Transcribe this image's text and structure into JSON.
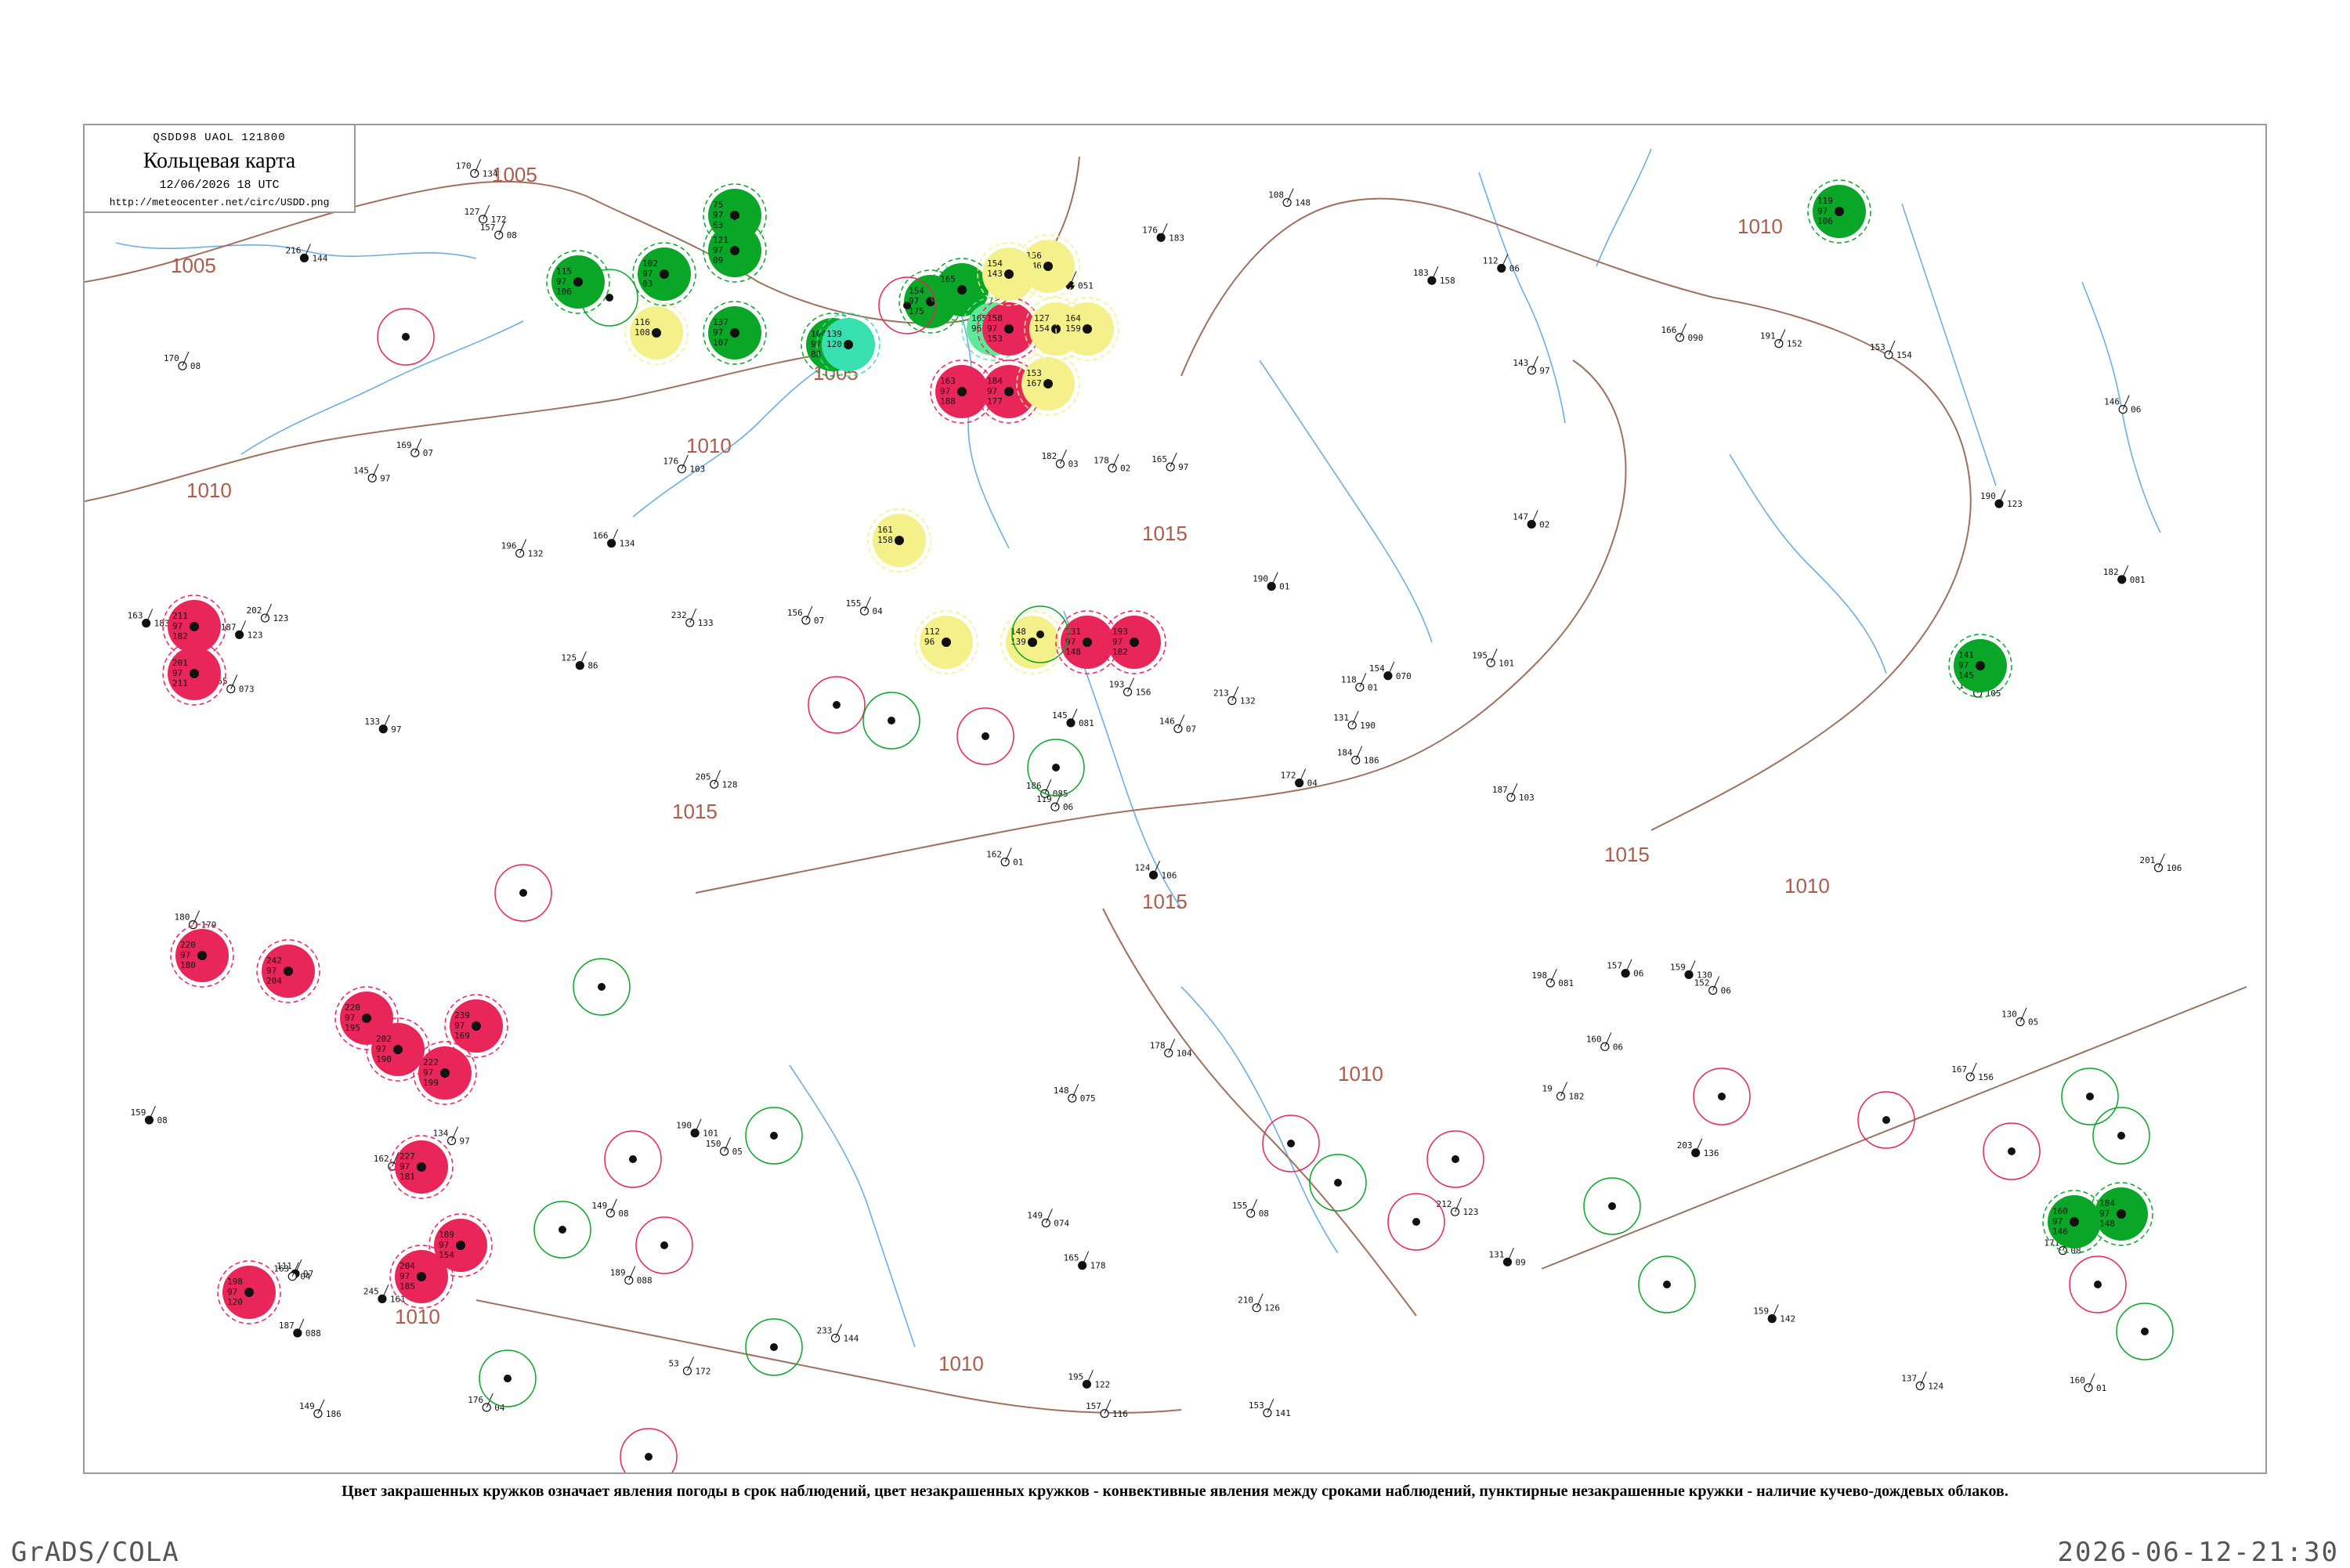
{
  "header": {
    "code": "QSDD98  UAOL  121800",
    "title": "Кольцевая карта",
    "date": "12/06/2026 18 UTC",
    "url": "http://meteocenter.net/circ/USDD.png"
  },
  "caption": "Цвет закрашенных кружков означает явления погоды в срок наблюдений, цвет незакрашенных кружков - конвективные явления между сроками наблюдений, пунктирные незакрашенные кружки - наличие кучево-дождевых облаков.",
  "footer": {
    "left": "GrADS/COLA",
    "right": "2026-06-12-21:30"
  },
  "colors": {
    "green": "#0aa628",
    "red": "#e8265a",
    "yellow": "#f4f08a",
    "cyan": "#38e0b0",
    "mint": "#5ee89a",
    "isobar": "#a0705a",
    "river": "#6aaee6"
  },
  "isobars": [
    "1005",
    "1010",
    "1015"
  ],
  "stations": [
    {
      "t": "Fg",
      "c": "green",
      "v": [
        "75",
        "97",
        "63"
      ]
    },
    {
      "t": "Fg",
      "c": "green",
      "v": [
        "121",
        "97",
        "09"
      ]
    },
    {
      "t": "Fg",
      "c": "green",
      "v": [
        "102",
        "97",
        "03"
      ]
    },
    {
      "t": "Fg",
      "c": "green",
      "v": [
        "115",
        "97",
        "106"
      ]
    },
    {
      "t": "Fg",
      "c": "yellow",
      "v": [
        "116",
        "108"
      ]
    },
    {
      "t": "Fg",
      "c": "green",
      "v": [
        "137",
        "97",
        "107"
      ]
    },
    {
      "t": "Fg",
      "c": "green",
      "v": [
        "104",
        "97",
        "88"
      ]
    },
    {
      "t": "Fg",
      "c": "cyan",
      "v": [
        "139",
        "120"
      ]
    },
    {
      "t": "Fg",
      "c": "green",
      "v": [
        "154",
        "97",
        "175"
      ]
    },
    {
      "t": "Fg",
      "c": "green",
      "v": [
        "165"
      ]
    },
    {
      "t": "Fg",
      "c": "mint",
      "v": [
        "165",
        "96"
      ]
    },
    {
      "t": "Fg",
      "c": "red",
      "v": [
        "158",
        "97",
        "153"
      ]
    },
    {
      "t": "Fg",
      "c": "red",
      "v": [
        "163",
        "97",
        "188"
      ]
    },
    {
      "t": "Fg",
      "c": "red",
      "v": [
        "184",
        "97",
        "177"
      ]
    },
    {
      "t": "Fg",
      "c": "yellow",
      "v": [
        "153",
        "167"
      ]
    },
    {
      "t": "Fg",
      "c": "yellow",
      "v": [
        "127",
        "154"
      ]
    },
    {
      "t": "Fg",
      "c": "yellow",
      "v": [
        "164",
        "159"
      ]
    },
    {
      "t": "Fg",
      "c": "yellow",
      "v": [
        "156",
        "146"
      ]
    },
    {
      "t": "Fg",
      "c": "yellow",
      "v": [
        "154",
        "143"
      ]
    },
    {
      "t": "Fg",
      "c": "yellow",
      "v": [
        "161",
        "158"
      ]
    },
    {
      "t": "Fg",
      "c": "yellow",
      "v": [
        "112",
        "96"
      ]
    },
    {
      "t": "Fg",
      "c": "yellow",
      "v": [
        "148",
        "139"
      ]
    },
    {
      "t": "Fg",
      "c": "red",
      "v": [
        "131",
        "97",
        "148"
      ]
    },
    {
      "t": "Fg",
      "c": "red",
      "v": [
        "193",
        "97",
        "182"
      ]
    },
    {
      "t": "Fg",
      "c": "red",
      "v": [
        "211",
        "97",
        "182"
      ]
    },
    {
      "t": "Fg",
      "c": "red",
      "v": [
        "201",
        "97",
        "211"
      ]
    },
    {
      "t": "Fg",
      "c": "red",
      "v": [
        "220",
        "97",
        "180"
      ]
    },
    {
      "t": "Fg",
      "c": "red",
      "v": [
        "242",
        "97",
        "204"
      ]
    },
    {
      "t": "Fg",
      "c": "red",
      "v": [
        "220",
        "97",
        "195"
      ]
    },
    {
      "t": "Fg",
      "c": "red",
      "v": [
        "202",
        "97",
        "190"
      ]
    },
    {
      "t": "Fg",
      "c": "red",
      "v": [
        "222",
        "97",
        "199"
      ]
    },
    {
      "t": "Fg",
      "c": "red",
      "v": [
        "239",
        "97",
        "169"
      ]
    },
    {
      "t": "Fg",
      "c": "red",
      "v": [
        "227",
        "97",
        "181"
      ]
    },
    {
      "t": "Fg",
      "c": "red",
      "v": [
        "204",
        "97",
        "185"
      ]
    },
    {
      "t": "Fg",
      "c": "red",
      "v": [
        "198",
        "97",
        "120"
      ]
    },
    {
      "t": "Fg",
      "c": "red",
      "v": [
        "189",
        "97",
        "154"
      ]
    },
    {
      "t": "Fg",
      "c": "green",
      "v": [
        "119",
        "97",
        "106"
      ]
    },
    {
      "t": "Fg",
      "c": "green",
      "v": [
        "141",
        "97",
        "145"
      ]
    },
    {
      "t": "Fg",
      "c": "green",
      "v": [
        "160",
        "97",
        "146"
      ]
    },
    {
      "t": "Fg",
      "c": "green",
      "v": [
        "184",
        "97",
        "148"
      ]
    }
  ],
  "plain": [
    [
      "124",
      "106"
    ],
    [
      "145",
      "97"
    ],
    [
      "119",
      "06"
    ],
    [
      "111",
      "97"
    ],
    [
      "118",
      "01"
    ],
    [
      "150",
      "05"
    ],
    [
      "112",
      "06"
    ],
    [
      "165",
      "97"
    ],
    [
      "143",
      "97"
    ],
    [
      "172",
      "04"
    ],
    [
      "157",
      "08"
    ],
    [
      "160",
      "01"
    ],
    [
      "133",
      "97"
    ],
    [
      "146",
      "06"
    ],
    [
      "162",
      "01"
    ],
    [
      "147",
      "02"
    ],
    [
      "176",
      "04"
    ],
    [
      "182",
      "03"
    ],
    [
      "190",
      "01"
    ],
    [
      "134",
      "97"
    ],
    [
      "155",
      "04"
    ],
    [
      "187",
      "088"
    ],
    [
      "189",
      "088"
    ],
    [
      "178",
      "02"
    ],
    [
      "154",
      "070"
    ],
    [
      "152",
      "06"
    ],
    [
      "169",
      "07"
    ],
    [
      "214",
      "051"
    ],
    [
      "155",
      "073"
    ],
    [
      "198",
      "081"
    ],
    [
      "182",
      "081"
    ],
    [
      "186",
      "085"
    ],
    [
      "149",
      "074"
    ],
    [
      "145",
      "081"
    ],
    [
      "176",
      "103"
    ],
    [
      "166",
      "090"
    ],
    [
      "190",
      "101"
    ],
    [
      "137",
      "124"
    ],
    [
      "171",
      "08"
    ],
    [
      "159",
      "130"
    ],
    [
      "108",
      "148"
    ],
    [
      "156",
      "07"
    ],
    [
      "125",
      "86"
    ],
    [
      "19",
      "182"
    ],
    [
      "53",
      "172"
    ],
    [
      "163",
      "183"
    ],
    [
      "131",
      "190"
    ],
    [
      "149",
      "186"
    ],
    [
      "165",
      "178"
    ],
    [
      "184",
      "186"
    ],
    [
      "162",
      "167"
    ],
    [
      "190",
      "123"
    ],
    [
      "170",
      "08"
    ],
    [
      "160",
      "06"
    ],
    [
      "131",
      "09"
    ],
    [
      "149",
      "08"
    ],
    [
      "127",
      "172"
    ],
    [
      "141",
      "182"
    ],
    [
      "155",
      "08"
    ],
    [
      "153",
      "154"
    ],
    [
      "176",
      "183"
    ],
    [
      "205",
      "128"
    ],
    [
      "202",
      "123"
    ],
    [
      "166",
      "134"
    ],
    [
      "191",
      "152"
    ],
    [
      "170",
      "134"
    ],
    [
      "183",
      "158"
    ],
    [
      "208",
      "102"
    ],
    [
      "193",
      "156"
    ],
    [
      "159",
      "08"
    ],
    [
      "148",
      "075"
    ],
    [
      "233",
      "144"
    ],
    [
      "157",
      "06"
    ],
    [
      "232",
      "133"
    ],
    [
      "163",
      "04"
    ],
    [
      "216",
      "144"
    ],
    [
      "196",
      "132"
    ],
    [
      "180",
      "179"
    ],
    [
      "193",
      "152"
    ],
    [
      "210",
      "126"
    ],
    [
      "213",
      "132"
    ],
    [
      "245",
      "161"
    ],
    [
      "187",
      "103"
    ],
    [
      "130",
      "05"
    ],
    [
      "195",
      "122"
    ],
    [
      "179",
      "105"
    ],
    [
      "178",
      "104"
    ],
    [
      "159",
      "142"
    ],
    [
      "153",
      "141"
    ],
    [
      "212",
      "123"
    ],
    [
      "230",
      "101"
    ],
    [
      "201",
      "106"
    ],
    [
      "195",
      "101"
    ],
    [
      "203",
      "136"
    ],
    [
      "146",
      "07"
    ],
    [
      "167",
      "156"
    ],
    [
      "187",
      "123"
    ],
    [
      "157",
      "116"
    ]
  ]
}
